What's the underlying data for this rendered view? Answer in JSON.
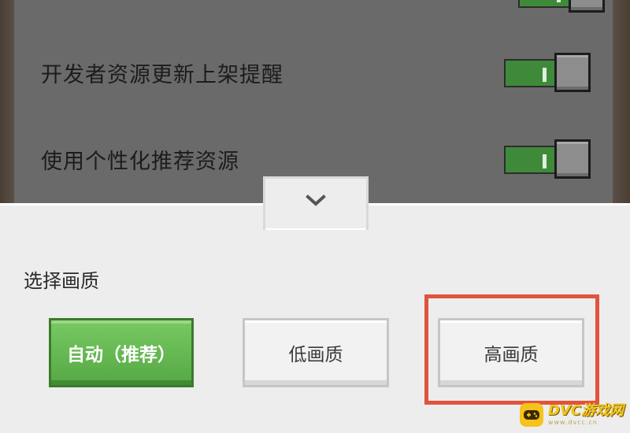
{
  "settings": {
    "rows": [
      {
        "label": "开发者资源更新上架提醒",
        "enabled": true
      },
      {
        "label": "使用个性化推荐资源",
        "enabled": true
      }
    ]
  },
  "drawer": {
    "collapse_icon": "chevron-down-icon",
    "section_title": "选择画质",
    "options": {
      "auto": "自动（推荐）",
      "low": "低画质",
      "high": "高画质"
    },
    "selected": "auto",
    "highlighted": "high"
  },
  "watermark": {
    "main": "DVC游戏网",
    "sub": "www.dvcc.cn",
    "icon": "gamepad-icon"
  },
  "colors": {
    "toggle_on": "#3f8a3a",
    "button_selected": "#5cb04a",
    "highlight": "#e0543c",
    "watermark": "#f3c51e"
  }
}
